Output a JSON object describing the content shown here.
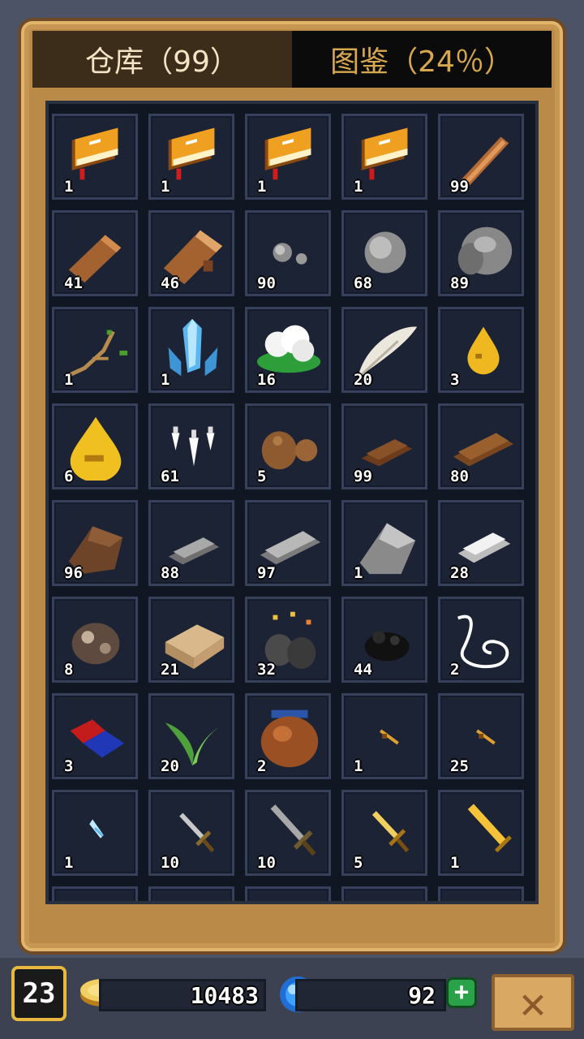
{
  "tabs": {
    "warehouse": "仓库（99）",
    "codex": "图鉴（24％）"
  },
  "items": [
    {
      "icon": "book-icon",
      "count": "1"
    },
    {
      "icon": "book-icon",
      "count": "1"
    },
    {
      "icon": "book-icon",
      "count": "1"
    },
    {
      "icon": "book-icon",
      "count": "1"
    },
    {
      "icon": "stick-icon",
      "count": "99"
    },
    {
      "icon": "log-icon",
      "count": "41"
    },
    {
      "icon": "big-log-icon",
      "count": "46"
    },
    {
      "icon": "pebbles-icon",
      "count": "90"
    },
    {
      "icon": "stone-icon",
      "count": "68"
    },
    {
      "icon": "boulder-icon",
      "count": "89"
    },
    {
      "icon": "branch-icon",
      "count": "1"
    },
    {
      "icon": "crystal-icon",
      "count": "1"
    },
    {
      "icon": "cotton-icon",
      "count": "16"
    },
    {
      "icon": "feather-icon",
      "count": "20"
    },
    {
      "icon": "small-drop-icon",
      "count": "3"
    },
    {
      "icon": "drop-icon",
      "count": "6"
    },
    {
      "icon": "fangs-icon",
      "count": "61"
    },
    {
      "icon": "clay-icon",
      "count": "5"
    },
    {
      "icon": "copper-bar-icon",
      "count": "99"
    },
    {
      "icon": "bronze-bar-icon",
      "count": "80"
    },
    {
      "icon": "ore-chunk-icon",
      "count": "96"
    },
    {
      "icon": "iron-bar-icon",
      "count": "88"
    },
    {
      "icon": "steel-bar-icon",
      "count": "97"
    },
    {
      "icon": "metal-chunk-icon",
      "count": "1"
    },
    {
      "icon": "silver-bar-icon",
      "count": "28"
    },
    {
      "icon": "rock-ore-icon",
      "count": "8"
    },
    {
      "icon": "sandstone-icon",
      "count": "21"
    },
    {
      "icon": "coal-ore-icon",
      "count": "32"
    },
    {
      "icon": "coal-icon",
      "count": "44"
    },
    {
      "icon": "string-icon",
      "count": "2"
    },
    {
      "icon": "magnet-icon",
      "count": "3"
    },
    {
      "icon": "herb-icon",
      "count": "20"
    },
    {
      "icon": "pot-icon",
      "count": "2"
    },
    {
      "icon": "small-dagger-icon",
      "count": "1"
    },
    {
      "icon": "small-dagger-icon",
      "count": "25"
    },
    {
      "icon": "ice-shard-icon",
      "count": "1"
    },
    {
      "icon": "iron-sword-icon",
      "count": "10"
    },
    {
      "icon": "steel-sword-icon",
      "count": "10"
    },
    {
      "icon": "gold-sword-icon",
      "count": "5"
    },
    {
      "icon": "gold-blade-icon",
      "count": "1"
    },
    {
      "icon": "partial-icon",
      "count": ""
    },
    {
      "icon": "partial-icon",
      "count": ""
    },
    {
      "icon": "partial-icon",
      "count": ""
    },
    {
      "icon": "partial-icon",
      "count": ""
    },
    {
      "icon": "partial-icon",
      "count": ""
    }
  ],
  "status": {
    "level": "23",
    "gold": "10483",
    "gems": "92",
    "add_label": "+",
    "close_label": "✕"
  }
}
